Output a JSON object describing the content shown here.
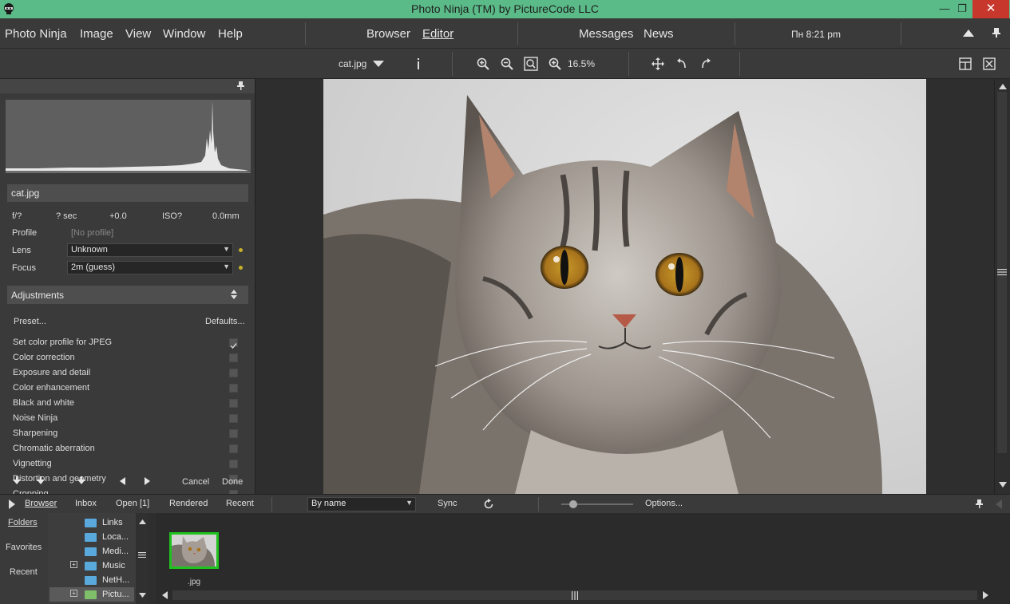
{
  "window": {
    "title": "Photo Ninja (TM) by PictureCode LLC",
    "minimize": "—",
    "restore": "❐",
    "close": "✕"
  },
  "menu": {
    "items": [
      "Photo Ninja",
      "Image",
      "View",
      "Window",
      "Help"
    ],
    "center_tabs": [
      "Browser",
      "Editor"
    ],
    "right_tabs": [
      "Messages",
      "News"
    ],
    "clock": "Пн 8:21 pm"
  },
  "toolbar": {
    "filename": "cat.jpg",
    "zoom": "16.5%"
  },
  "info_panel": {
    "filename": "cat.jpg",
    "exif": [
      "f/?",
      "? sec",
      "+0.0",
      "ISO?",
      "0.0mm"
    ],
    "profile_label": "Profile",
    "profile_value": "[No profile]",
    "lens_label": "Lens",
    "lens_value": "Unknown",
    "focus_label": "Focus",
    "focus_value": "2m (guess)"
  },
  "adjustments": {
    "header": "Adjustments",
    "preset": "Preset...",
    "defaults": "Defaults...",
    "items": [
      {
        "label": "Set color profile for JPEG",
        "checked": true
      },
      {
        "label": "Color correction",
        "checked": false
      },
      {
        "label": "Exposure and detail",
        "checked": false
      },
      {
        "label": "Color enhancement",
        "checked": false
      },
      {
        "label": "Black and white",
        "checked": false
      },
      {
        "label": "Noise Ninja",
        "checked": false
      },
      {
        "label": "Sharpening",
        "checked": false
      },
      {
        "label": "Chromatic aberration",
        "checked": false
      },
      {
        "label": "Vignetting",
        "checked": false
      },
      {
        "label": "Distortion and geometry",
        "checked": false
      },
      {
        "label": "Cropping",
        "checked": false
      }
    ],
    "cancel": "Cancel",
    "done": "Done"
  },
  "browser_bar": {
    "tabs": [
      "Browser",
      "Inbox",
      "Open [1]",
      "Rendered",
      "Recent"
    ],
    "sort": "By name",
    "sync": "Sync",
    "options": "Options..."
  },
  "browser_side": {
    "tabs": [
      "Folders",
      "Favorites",
      "Recent"
    ]
  },
  "folder_tree": {
    "rows": [
      "Links",
      "Loca...",
      "Medi...",
      "Music",
      "NetH...",
      "Pictu..."
    ]
  },
  "thumbnails": [
    {
      "label": ".jpg"
    }
  ],
  "colors": {
    "titlebar": "#5bbb88",
    "accent_dot": "#c6b02a",
    "thumb_border": "#1fc21f",
    "close_red": "#c7372c"
  }
}
